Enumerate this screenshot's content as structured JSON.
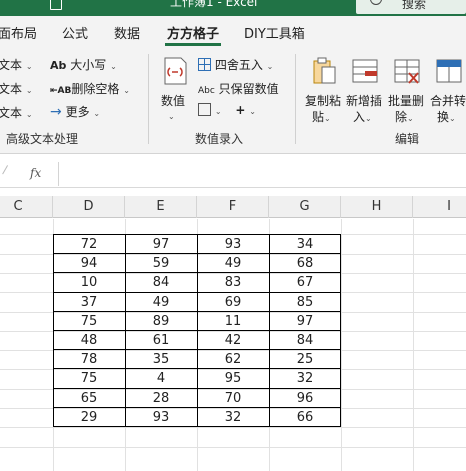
{
  "titlebar": {
    "title": "工作簿1 - Excel",
    "search_label": "搜索"
  },
  "tabs": [
    "面布局",
    "公式",
    "数据",
    "方方格子",
    "DIY工具箱"
  ],
  "active_tab": "方方格子",
  "ribbon": {
    "text_group": {
      "left_items": [
        "文本",
        "文本",
        "文本"
      ],
      "items": [
        "大小写",
        "删除空格",
        "更多"
      ],
      "title": "高级文本处理"
    },
    "number_group": {
      "big_button": "数值",
      "items": [
        "四舍五入",
        "只保留数值"
      ],
      "title": "数值录入"
    },
    "edit_group": {
      "buttons": [
        [
          "复制粘",
          "贴"
        ],
        [
          "新增插",
          "入"
        ],
        [
          "批量删",
          "除"
        ],
        [
          "合并转",
          "换"
        ]
      ],
      "title": "编辑"
    }
  },
  "formula_bar": {
    "fx": "fx",
    "value": ""
  },
  "columns": [
    "C",
    "D",
    "E",
    "F",
    "G",
    "H",
    "I"
  ],
  "table": [
    [
      72,
      97,
      93,
      34
    ],
    [
      94,
      59,
      49,
      68
    ],
    [
      10,
      84,
      83,
      67
    ],
    [
      37,
      49,
      69,
      85
    ],
    [
      75,
      89,
      11,
      97
    ],
    [
      48,
      61,
      42,
      84
    ],
    [
      78,
      35,
      62,
      25
    ],
    [
      75,
      4,
      95,
      32
    ],
    [
      65,
      28,
      70,
      96
    ],
    [
      29,
      93,
      32,
      66
    ]
  ],
  "colors": {
    "accent": "#217346",
    "ribbon_bg": "#f3f3f3"
  },
  "icons": [
    "save-icon",
    "search-icon",
    "case-icon",
    "delete-space-icon",
    "more-icon",
    "value-icon",
    "round-icon",
    "keep-value-icon",
    "copy-paste-icon",
    "insert-icon",
    "batch-delete-icon",
    "merge-convert-icon"
  ]
}
